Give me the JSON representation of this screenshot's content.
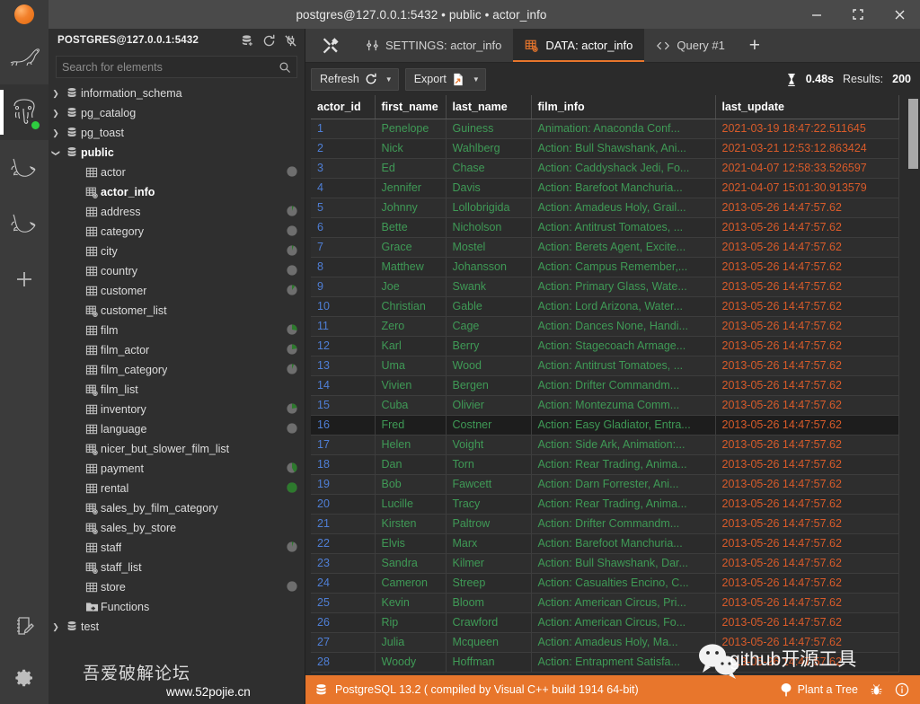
{
  "window": {
    "title": "postgres@127.0.0.1:5432 • public • actor_info",
    "minimize_label": "—",
    "maximize_label": "⛶",
    "close_label": "✕",
    "logo_icon": "app-logo-icon"
  },
  "rail": {
    "items": [
      {
        "id": "mariadb",
        "icon": "sea-lion-icon",
        "active": false,
        "online": false
      },
      {
        "id": "postgres",
        "icon": "elephant-icon",
        "active": true,
        "online": true
      },
      {
        "id": "mysql-1",
        "icon": "dolphin-icon",
        "active": false,
        "online": false
      },
      {
        "id": "mysql-2",
        "icon": "dolphin-icon",
        "active": false,
        "online": false
      },
      {
        "id": "add-connection",
        "icon": "plus-icon",
        "active": false,
        "online": false
      }
    ],
    "bottom_items": [
      {
        "id": "notes",
        "icon": "notebook-pencil-icon"
      },
      {
        "id": "settings",
        "icon": "gear-icon"
      }
    ]
  },
  "navigator": {
    "title": "POSTGRES@127.0.0.1:5432",
    "header_icons": [
      {
        "id": "new-database",
        "icon": "database-plus-icon"
      },
      {
        "id": "refresh",
        "icon": "refresh-icon"
      },
      {
        "id": "disconnect",
        "icon": "plug-off-icon"
      }
    ],
    "search": {
      "placeholder": "Search for elements",
      "value": "",
      "icon": "search-icon"
    },
    "tree": [
      {
        "label": "information_schema",
        "type": "schema",
        "depth": 0,
        "expanded": false,
        "bold": false,
        "pie": null
      },
      {
        "label": "pg_catalog",
        "type": "schema",
        "depth": 0,
        "expanded": false,
        "bold": false,
        "pie": null
      },
      {
        "label": "pg_toast",
        "type": "schema",
        "depth": 0,
        "expanded": false,
        "bold": false,
        "pie": null
      },
      {
        "label": "public",
        "type": "schema",
        "depth": 0,
        "expanded": true,
        "bold": true,
        "pie": null
      },
      {
        "label": "actor",
        "type": "table",
        "depth": 1,
        "bold": false,
        "pie": 0
      },
      {
        "label": "actor_info",
        "type": "view",
        "depth": 1,
        "bold": true,
        "pie": null
      },
      {
        "label": "address",
        "type": "table",
        "depth": 1,
        "bold": false,
        "pie": 5
      },
      {
        "label": "category",
        "type": "table",
        "depth": 1,
        "bold": false,
        "pie": 0
      },
      {
        "label": "city",
        "type": "table",
        "depth": 1,
        "bold": false,
        "pie": 5
      },
      {
        "label": "country",
        "type": "table",
        "depth": 1,
        "bold": false,
        "pie": 0
      },
      {
        "label": "customer",
        "type": "table",
        "depth": 1,
        "bold": false,
        "pie": 10
      },
      {
        "label": "customer_list",
        "type": "view",
        "depth": 1,
        "bold": false,
        "pie": null
      },
      {
        "label": "film",
        "type": "table",
        "depth": 1,
        "bold": false,
        "pie": 28
      },
      {
        "label": "film_actor",
        "type": "table",
        "depth": 1,
        "bold": false,
        "pie": 22
      },
      {
        "label": "film_category",
        "type": "table",
        "depth": 1,
        "bold": false,
        "pie": 6
      },
      {
        "label": "film_list",
        "type": "view",
        "depth": 1,
        "bold": false,
        "pie": null
      },
      {
        "label": "inventory",
        "type": "table",
        "depth": 1,
        "bold": false,
        "pie": 22
      },
      {
        "label": "language",
        "type": "table",
        "depth": 1,
        "bold": false,
        "pie": 0
      },
      {
        "label": "nicer_but_slower_film_list",
        "type": "view",
        "depth": 1,
        "bold": false,
        "pie": null
      },
      {
        "label": "payment",
        "type": "table",
        "depth": 1,
        "bold": false,
        "pie": 42
      },
      {
        "label": "rental",
        "type": "table",
        "depth": 1,
        "bold": false,
        "pie": 100
      },
      {
        "label": "sales_by_film_category",
        "type": "view",
        "depth": 1,
        "bold": false,
        "pie": null
      },
      {
        "label": "sales_by_store",
        "type": "view",
        "depth": 1,
        "bold": false,
        "pie": null
      },
      {
        "label": "staff",
        "type": "table",
        "depth": 1,
        "bold": false,
        "pie": 5
      },
      {
        "label": "staff_list",
        "type": "view",
        "depth": 1,
        "bold": false,
        "pie": null
      },
      {
        "label": "store",
        "type": "table",
        "depth": 1,
        "bold": false,
        "pie": 0
      },
      {
        "label": "Functions",
        "type": "folder",
        "depth": 1,
        "bold": false,
        "pie": null
      },
      {
        "label": "test",
        "type": "schema",
        "depth": 0,
        "expanded": false,
        "bold": false,
        "pie": null
      }
    ]
  },
  "tabs": {
    "tools_icon": "tools-icon",
    "items": [
      {
        "label": "SETTINGS: actor_info",
        "icon": "sliders-icon",
        "active": false
      },
      {
        "label": "DATA: actor_info",
        "icon": "view-table-icon",
        "active": true
      },
      {
        "label": "Query #1",
        "icon": "code-brackets-icon",
        "active": false
      }
    ],
    "add_label": "+",
    "accent_color": "#e8762c"
  },
  "toolbar": {
    "refresh_label": "Refresh",
    "refresh_icon": "refresh-icon",
    "export_label": "Export",
    "export_icon": "export-file-icon",
    "caret_glyph": "▼",
    "duration_icon": "hourglass-icon",
    "duration": "0.48s",
    "results_label": "Results:",
    "results_count": "200"
  },
  "grid": {
    "columns": [
      "actor_id",
      "first_name",
      "last_name",
      "film_info",
      "last_update"
    ],
    "highlighted_row_index": 15,
    "rows": [
      [
        "1",
        "Penelope",
        "Guiness",
        "Animation: Anaconda Conf...",
        "2021-03-19 18:47:22.511645"
      ],
      [
        "2",
        "Nick",
        "Wahlberg",
        "Action: Bull Shawshank, Ani...",
        "2021-03-21 12:53:12.863424"
      ],
      [
        "3",
        "Ed",
        "Chase",
        "Action: Caddyshack Jedi, Fo...",
        "2021-04-07 12:58:33.526597"
      ],
      [
        "4",
        "Jennifer",
        "Davis",
        "Action: Barefoot Manchuria...",
        "2021-04-07 15:01:30.913579"
      ],
      [
        "5",
        "Johnny",
        "Lollobrigida",
        "Action: Amadeus Holy, Grail...",
        "2013-05-26 14:47:57.62"
      ],
      [
        "6",
        "Bette",
        "Nicholson",
        "Action: Antitrust Tomatoes, ...",
        "2013-05-26 14:47:57.62"
      ],
      [
        "7",
        "Grace",
        "Mostel",
        "Action: Berets Agent, Excite...",
        "2013-05-26 14:47:57.62"
      ],
      [
        "8",
        "Matthew",
        "Johansson",
        "Action: Campus Remember,...",
        "2013-05-26 14:47:57.62"
      ],
      [
        "9",
        "Joe",
        "Swank",
        "Action: Primary Glass, Wate...",
        "2013-05-26 14:47:57.62"
      ],
      [
        "10",
        "Christian",
        "Gable",
        "Action: Lord Arizona, Water...",
        "2013-05-26 14:47:57.62"
      ],
      [
        "11",
        "Zero",
        "Cage",
        "Action: Dances None, Handi...",
        "2013-05-26 14:47:57.62"
      ],
      [
        "12",
        "Karl",
        "Berry",
        "Action: Stagecoach Armage...",
        "2013-05-26 14:47:57.62"
      ],
      [
        "13",
        "Uma",
        "Wood",
        "Action: Antitrust Tomatoes, ...",
        "2013-05-26 14:47:57.62"
      ],
      [
        "14",
        "Vivien",
        "Bergen",
        "Action: Drifter Commandm...",
        "2013-05-26 14:47:57.62"
      ],
      [
        "15",
        "Cuba",
        "Olivier",
        "Action: Montezuma Comm...",
        "2013-05-26 14:47:57.62"
      ],
      [
        "16",
        "Fred",
        "Costner",
        "Action: Easy Gladiator, Entra...",
        "2013-05-26 14:47:57.62"
      ],
      [
        "17",
        "Helen",
        "Voight",
        "Action: Side Ark, Animation:...",
        "2013-05-26 14:47:57.62"
      ],
      [
        "18",
        "Dan",
        "Torn",
        "Action: Rear Trading, Anima...",
        "2013-05-26 14:47:57.62"
      ],
      [
        "19",
        "Bob",
        "Fawcett",
        "Action: Darn Forrester, Ani...",
        "2013-05-26 14:47:57.62"
      ],
      [
        "20",
        "Lucille",
        "Tracy",
        "Action: Rear Trading, Anima...",
        "2013-05-26 14:47:57.62"
      ],
      [
        "21",
        "Kirsten",
        "Paltrow",
        "Action: Drifter Commandm...",
        "2013-05-26 14:47:57.62"
      ],
      [
        "22",
        "Elvis",
        "Marx",
        "Action: Barefoot Manchuria...",
        "2013-05-26 14:47:57.62"
      ],
      [
        "23",
        "Sandra",
        "Kilmer",
        "Action: Bull Shawshank, Dar...",
        "2013-05-26 14:47:57.62"
      ],
      [
        "24",
        "Cameron",
        "Streep",
        "Action: Casualties Encino, C...",
        "2013-05-26 14:47:57.62"
      ],
      [
        "25",
        "Kevin",
        "Bloom",
        "Action: American Circus, Pri...",
        "2013-05-26 14:47:57.62"
      ],
      [
        "26",
        "Rip",
        "Crawford",
        "Action: American Circus, Fo...",
        "2013-05-26 14:47:57.62"
      ],
      [
        "27",
        "Julia",
        "Mcqueen",
        "Action: Amadeus Holy, Ma...",
        "2013-05-26 14:47:57.62"
      ],
      [
        "28",
        "Woody",
        "Hoffman",
        "Action: Entrapment Satisfa...",
        "2013-05-26 14:47:57.62"
      ]
    ]
  },
  "status": {
    "server_icon": "database-icon",
    "server_text": "PostgreSQL 13.2 ( compiled by Visual C++ build 1914 64-bit)",
    "plant_a_tree_label": "Plant a Tree",
    "tree_icon": "tree-icon",
    "bug_icon": "bug-icon",
    "info_icon": "info-icon",
    "background_color": "#e8762c"
  },
  "watermarks": {
    "forum_cn": "吾爱破解论坛",
    "forum_url": "www.52pojie.cn",
    "github_cn": "github开源工具",
    "wechat_icon": "wechat-icon"
  }
}
